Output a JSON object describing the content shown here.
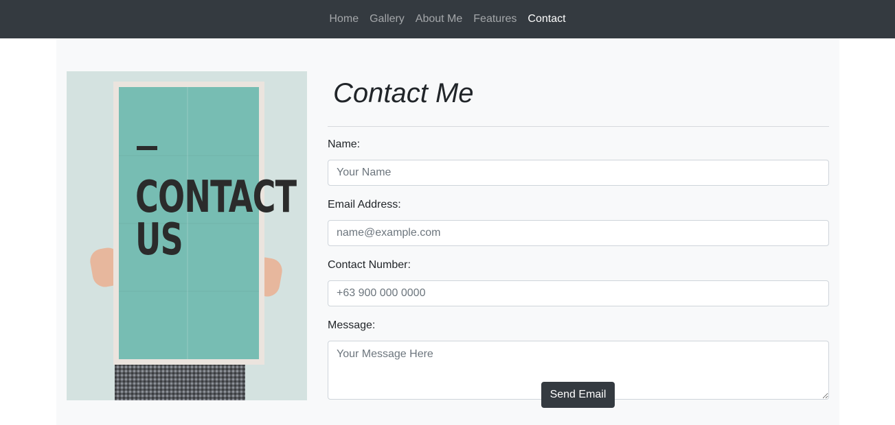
{
  "nav": {
    "items": [
      {
        "label": "Home",
        "active": false
      },
      {
        "label": "Gallery",
        "active": false
      },
      {
        "label": "About Me",
        "active": false
      },
      {
        "label": "Features",
        "active": false
      },
      {
        "label": "Contact",
        "active": true
      }
    ]
  },
  "image": {
    "poster_text": "CONTACT\nUS"
  },
  "form": {
    "title": "Contact Me",
    "fields": [
      {
        "label": "Name:",
        "placeholder": "Your Name"
      },
      {
        "label": "Email Address:",
        "placeholder": "name@example.com"
      },
      {
        "label": "Contact Number:",
        "placeholder": "+63 900 000 0000"
      },
      {
        "label": "Message:",
        "placeholder": "Your Message Here"
      }
    ],
    "submit_label": "Send Email"
  },
  "colors": {
    "navbar": "#343a40",
    "page_bg": "#f8f9fa",
    "button": "#343a40",
    "poster": "#77bdb3"
  }
}
